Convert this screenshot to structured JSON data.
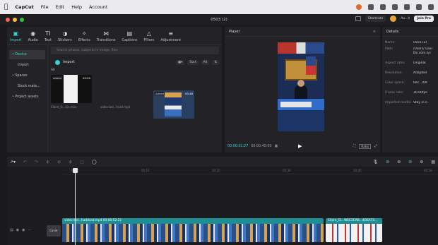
{
  "menubar": {
    "app_name": "CapCut",
    "items": [
      "File",
      "Edit",
      "Help",
      "Account"
    ]
  },
  "window": {
    "title": "0503 (2)",
    "shortcuts_label": "Shortcuts",
    "user_label": "Au...h",
    "join_label": "Join Pro"
  },
  "tools": [
    {
      "label": "Import",
      "icon": "import-icon",
      "active": true
    },
    {
      "label": "Audio",
      "icon": "audio-icon"
    },
    {
      "label": "Text",
      "icon": "text-icon"
    },
    {
      "label": "Stickers",
      "icon": "stickers-icon"
    },
    {
      "label": "Effects",
      "icon": "effects-icon"
    },
    {
      "label": "Transitions",
      "icon": "transitions-icon"
    },
    {
      "label": "Captions",
      "icon": "captions-icon"
    },
    {
      "label": "Filters",
      "icon": "filters-icon"
    },
    {
      "label": "Adjustment",
      "icon": "adjustment-icon"
    }
  ],
  "media_sidebar": {
    "items": [
      "• Device",
      "Import",
      "• Spaces",
      "Stock mate...",
      "• Project assets"
    ]
  },
  "media": {
    "search_placeholder": "Search photos, subjects in image, files",
    "import_label": "Import",
    "sort_label": "Sort",
    "filter_all": "All",
    "section_label": "All",
    "items": [
      {
        "badge": "Added",
        "duration": "00:00",
        "name": "Claire_G...ion.mov"
      },
      {
        "badge": "Added",
        "duration": "00:48",
        "name": "video-bel...hsad.mp4"
      }
    ]
  },
  "player": {
    "title": "Player",
    "current_time": "00:00:01:27",
    "total_time": "00:00:45:00",
    "ratio_label": "Ratio"
  },
  "details": {
    "title": "Details",
    "rows": [
      {
        "k": "Name:",
        "v": "0503 (2)"
      },
      {
        "k": "Path:",
        "v": "/Users/ User Do com.lvc"
      },
      {
        "k": "Aspect ratio:",
        "v": "Original"
      },
      {
        "k": "Resolution:",
        "v": "Adapted"
      },
      {
        "k": "Color space:",
        "v": "Rec. 709"
      },
      {
        "k": "Frame rate:",
        "v": "30.00fps"
      },
      {
        "k": "Imported media:",
        "v": "Stay in o"
      }
    ]
  },
  "timeline": {
    "ticks": [
      "00:00",
      "00:10",
      "00:20",
      "00:30",
      "00:40",
      "00:50"
    ],
    "cover_label": "Cover",
    "clips": [
      {
        "label": "video-bel...haddsad.mp4   00:00:52:22"
      },
      {
        "label": "Claire_Gi...WEC2CAB...4DEA73..."
      }
    ]
  }
}
